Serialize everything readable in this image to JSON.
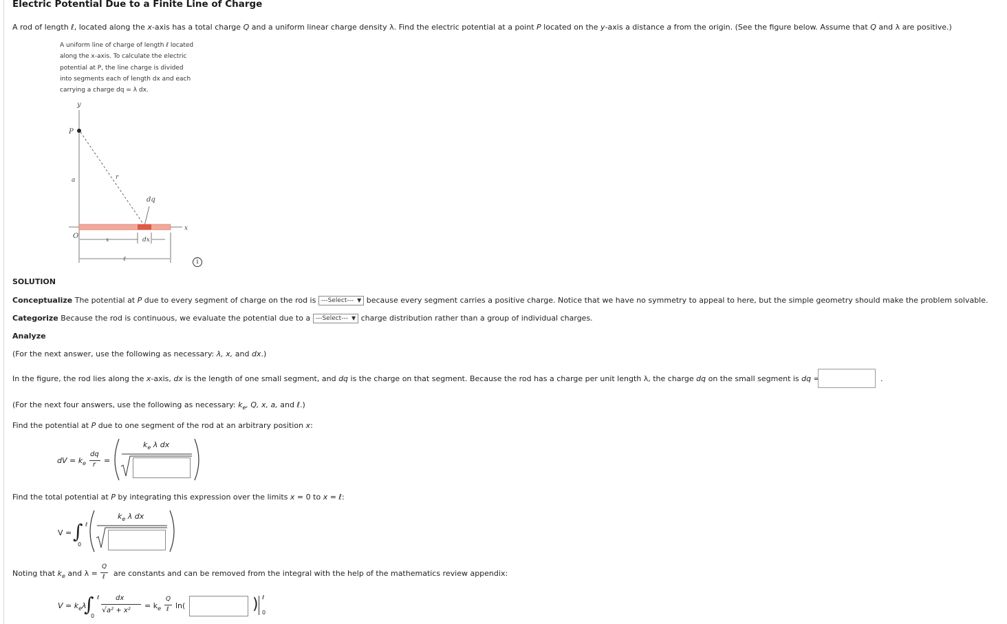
{
  "title": "Electric Potential Due to a Finite Line of Charge",
  "problem": {
    "p1": "A rod of length ",
    "ell": "ℓ",
    "p2": ", located along the ",
    "x": "x",
    "p3": "-axis has a total charge ",
    "Q": "Q",
    "p4": " and a uniform linear charge density ",
    "lambda": "λ",
    "p5": ". Find the electric potential at a point ",
    "P": "P",
    "p6": " located on the ",
    "y": "y",
    "p7": "-axis a distance ",
    "a": "a",
    "p8": " from the origin. (See the figure below. Assume that ",
    "p9": " and ",
    "p10": " are positive.)"
  },
  "figure_caption": [
    "A uniform line of charge of length ℓ located",
    "along the x-axis. To calculate the electric",
    "potential at P, the line charge is divided",
    "into segments each of length dx and each",
    "carrying a charge dq = λ dx."
  ],
  "figure_labels": {
    "y": "y",
    "P": "P",
    "a": "a",
    "r": "r",
    "dq": "dq",
    "x_axis": "x",
    "O": "O",
    "x_dim": "x",
    "dx": "dx",
    "ell": "ℓ"
  },
  "info_icon": "i",
  "solution_heading": "SOLUTION",
  "conceptualize": {
    "label": "Conceptualize",
    "text1": " The potential at ",
    "P": "P",
    "text2": " due to every segment of charge on the rod is ",
    "select": "---Select---",
    "text3": " because every segment carries a positive charge. Notice that we have no symmetry to appeal to here, but the simple geometry should make the problem solvable."
  },
  "categorize": {
    "label": "Categorize",
    "text1": " Because the rod is continuous, we evaluate the potential due to a ",
    "select": "---Select---",
    "text2": " charge distribution rather than a group of individual charges."
  },
  "analyze_heading": "Analyze",
  "note1": {
    "pre": "(For the next answer, use the following as necessary: ",
    "vars": "λ, x,",
    "mid": " and ",
    "dx": "dx",
    "post": ".)"
  },
  "para1": {
    "t1": "In the figure, the rod lies along the ",
    "x": "x",
    "t2": "-axis, ",
    "dx": "dx",
    "t3": " is the length of one small segment, and ",
    "dq": "dq",
    "t4": " is the charge on that segment. Because the rod has a charge per unit length λ, the charge ",
    "dq2": "dq",
    "t5": " on the small segment is ",
    "dq3": "dq",
    "t6": " =",
    "period": "."
  },
  "note2": {
    "pre": "(For the next four answers, use the following as necessary: ",
    "k": "k",
    "sub": "e",
    "vars": ", Q, x, a,",
    "mid": " and ",
    "ell": "ℓ",
    "post": ".)"
  },
  "find1": {
    "t1": "Find the potential at ",
    "P": "P",
    "t2": " due to one segment of the rod at an arbitrary position ",
    "x": "x",
    "t3": ":"
  },
  "eq1": {
    "lhs": "dV = k",
    "sub": "e",
    "num": "dq",
    "den": "r",
    "eq": "=",
    "numer": "k",
    "numer_sub": "e",
    "numer_rest": " λ dx"
  },
  "find2": {
    "t1": "Find the total potential at ",
    "P": "P",
    "t2": " by integrating this expression over the limits ",
    "x": "x",
    "t3": " = 0 to ",
    "x2": "x",
    "t4": " = ℓ:"
  },
  "eq2": {
    "lhs": "V =",
    "upper": "ℓ",
    "lower": "0",
    "numer": "k",
    "numer_sub": "e",
    "numer_rest": " λ dx"
  },
  "noting": {
    "t1": "Noting that ",
    "k": "k",
    "sub": "e",
    "t2": " and λ = ",
    "num": "Q",
    "den": "ℓ",
    "t3": " are constants and can be removed from the integral with the help of the mathematics review appendix:"
  },
  "eq3": {
    "lhs": "V = k",
    "sub": "e",
    "lam": "λ",
    "upper": "ℓ",
    "lower": "0",
    "num": "dx",
    "den": "a² + x²",
    "eq": "= k",
    "sub2": "e",
    "fnum": "Q",
    "fden": "ℓ",
    "ln": "ln(",
    "close": ")",
    "lim_upper": "ℓ",
    "lim_lower": "0"
  }
}
